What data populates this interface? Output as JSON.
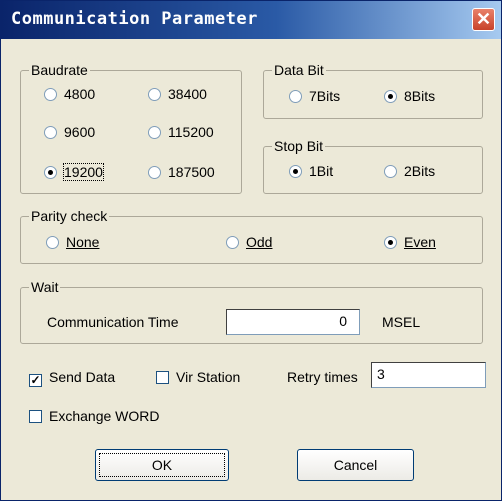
{
  "dialog": {
    "title": "Communication Parameter",
    "close_glyph": "✕"
  },
  "baudrate": {
    "legend": "Baudrate",
    "options": [
      {
        "label": "4800",
        "selected": false
      },
      {
        "label": "38400",
        "selected": false
      },
      {
        "label": "9600",
        "selected": false
      },
      {
        "label": "115200",
        "selected": false
      },
      {
        "label": "19200",
        "selected": true
      },
      {
        "label": "187500",
        "selected": false
      }
    ]
  },
  "data_bit": {
    "legend": "Data Bit",
    "options": [
      {
        "label": "7Bits",
        "selected": false
      },
      {
        "label": "8Bits",
        "selected": true
      }
    ]
  },
  "stop_bit": {
    "legend": "Stop Bit",
    "options": [
      {
        "label": "1Bit",
        "selected": true
      },
      {
        "label": "2Bits",
        "selected": false
      }
    ]
  },
  "parity": {
    "legend": "Parity check",
    "options": [
      {
        "label": "None",
        "selected": false
      },
      {
        "label": "Odd",
        "selected": false
      },
      {
        "label": "Even",
        "selected": true
      }
    ]
  },
  "wait": {
    "legend": "Wait",
    "label": "Communication Time",
    "value": "0",
    "unit": "MSEL"
  },
  "send_data": {
    "label": "Send Data",
    "checked": true
  },
  "vir_station": {
    "label": "Vir Station",
    "checked": false
  },
  "retry": {
    "label": "Retry times",
    "value": "3"
  },
  "exchange_word": {
    "label": "Exchange WORD",
    "checked": false
  },
  "buttons": {
    "ok": "OK",
    "cancel": "Cancel"
  },
  "colors": {
    "titlebar_start": "#0a246a",
    "titlebar_end": "#a6caf0",
    "close_button": "#c8422a",
    "dialog_bg": "#ece9d8"
  }
}
